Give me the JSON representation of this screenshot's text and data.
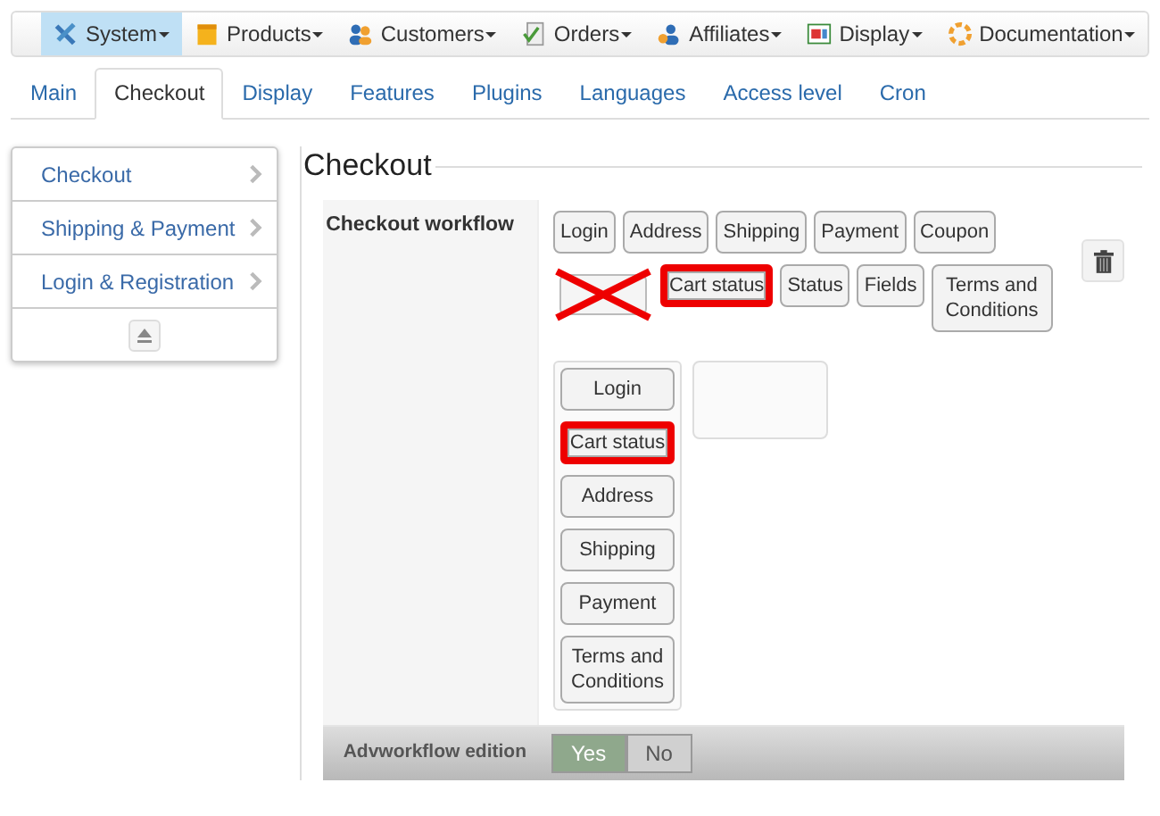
{
  "menu": [
    {
      "label": "System",
      "selected": true
    },
    {
      "label": "Products",
      "selected": false
    },
    {
      "label": "Customers",
      "selected": false
    },
    {
      "label": "Orders",
      "selected": false
    },
    {
      "label": "Affiliates",
      "selected": false
    },
    {
      "label": "Display",
      "selected": false
    },
    {
      "label": "Documentation",
      "selected": false
    }
  ],
  "tabs": [
    {
      "label": "Main",
      "selected": false
    },
    {
      "label": "Checkout",
      "selected": true
    },
    {
      "label": "Display",
      "selected": false
    },
    {
      "label": "Features",
      "selected": false
    },
    {
      "label": "Plugins",
      "selected": false
    },
    {
      "label": "Languages",
      "selected": false
    },
    {
      "label": "Access level",
      "selected": false
    },
    {
      "label": "Cron",
      "selected": false
    }
  ],
  "sidebar": {
    "items": [
      {
        "label": "Checkout"
      },
      {
        "label": "Shipping & Payment"
      },
      {
        "label": "Login & Registration"
      }
    ]
  },
  "section": {
    "legend": "Checkout",
    "workflow": {
      "label": "Checkout workflow",
      "pool": [
        {
          "kind": "button",
          "label": "Login",
          "highlighted": false
        },
        {
          "kind": "button",
          "label": "Address",
          "highlighted": false
        },
        {
          "kind": "button",
          "label": "Shipping",
          "highlighted": false
        },
        {
          "kind": "button",
          "label": "Payment",
          "highlighted": false
        },
        {
          "kind": "button",
          "label": "Coupon",
          "highlighted": false
        },
        {
          "kind": "crossed-slot"
        },
        {
          "kind": "button",
          "label": "Cart status",
          "highlighted": true
        },
        {
          "kind": "button",
          "label": "Status",
          "highlighted": false
        },
        {
          "kind": "button",
          "label": "Fields",
          "highlighted": false
        },
        {
          "kind": "button",
          "label": "Terms and Conditions",
          "highlighted": false
        }
      ],
      "step": [
        {
          "label": "Login",
          "highlighted": false
        },
        {
          "label": "Cart status",
          "highlighted": true
        },
        {
          "label": "Address",
          "highlighted": false
        },
        {
          "label": "Shipping",
          "highlighted": false
        },
        {
          "label": "Payment",
          "highlighted": false
        },
        {
          "label": "Terms and Conditions",
          "highlighted": false
        }
      ]
    },
    "footer_row": {
      "label": "Advworkflow edition",
      "options": [
        {
          "label": "Yes",
          "selected": true
        },
        {
          "label": "No",
          "selected": false
        }
      ]
    }
  }
}
